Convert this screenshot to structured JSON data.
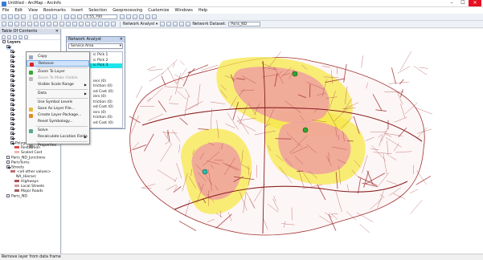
{
  "window": {
    "title": "Untitled - ArcMap - ArcInfo",
    "minimize": "–",
    "maximize": "☐",
    "close": "✕"
  },
  "menu": [
    "File",
    "Edit",
    "View",
    "Bookmarks",
    "Insert",
    "Selection",
    "Geoprocessing",
    "Customize",
    "Windows",
    "Help"
  ],
  "toolbar": {
    "scale": "1:55,700",
    "network_analyst_label": "Network Analyst ▾",
    "network_dataset_label": "Network Dataset:",
    "network_dataset_value": "Paris_ND"
  },
  "toc": {
    "title": "Table Of Contents",
    "close": "✕",
    "items": [
      {
        "label": "Layers",
        "indent": 0,
        "check": false,
        "bold": true
      },
      {
        "label": "",
        "indent": 1,
        "check": true,
        "selected": true
      },
      {
        "label": "",
        "indent": 2,
        "check": true
      },
      {
        "label": "",
        "indent": 2,
        "check": true
      },
      {
        "label": "",
        "indent": 2,
        "check": true
      },
      {
        "label": "",
        "indent": 2,
        "check": true
      },
      {
        "label": "",
        "indent": 2,
        "check": true
      },
      {
        "label": "",
        "indent": 2,
        "check": true
      },
      {
        "label": "",
        "indent": 2,
        "check": true
      },
      {
        "label": "",
        "indent": 2,
        "check": true
      },
      {
        "label": "",
        "indent": 2,
        "check": true
      },
      {
        "label": "",
        "indent": 2,
        "check": true
      },
      {
        "label": "",
        "indent": 2,
        "check": true
      },
      {
        "label": "",
        "indent": 2,
        "check": true
      },
      {
        "label": "",
        "indent": 2,
        "check": true
      },
      {
        "label": "",
        "indent": 2,
        "check": true
      },
      {
        "label": "",
        "indent": 2,
        "check": true
      },
      {
        "label": "",
        "indent": 2,
        "check": true
      },
      {
        "label": "",
        "indent": 2,
        "check": true
      },
      {
        "label": "",
        "indent": 2,
        "check": true
      },
      {
        "label": "",
        "indent": 2,
        "check": true
      },
      {
        "label": "Polygon Barriers",
        "indent": 2,
        "check": true
      },
      {
        "label": "Restriction",
        "indent": 3,
        "swatch": "#e24a4a"
      },
      {
        "label": "Scaled Cost",
        "indent": 3,
        "swatch": "#f2b3b3"
      },
      {
        "label": "Paris_ND_Junctions",
        "indent": 1,
        "check": false
      },
      {
        "label": "ParisTurns",
        "indent": 1,
        "check": false
      },
      {
        "label": "Streets",
        "indent": 1,
        "check": true
      },
      {
        "label": "<all other values>",
        "indent": 2,
        "swatch": "#c07070"
      },
      {
        "label": "NA_Hierarc",
        "indent": 3,
        "swatch": ""
      },
      {
        "label": "Highways",
        "indent": 3,
        "swatch": "#b05050"
      },
      {
        "label": "Local Streets",
        "indent": 3,
        "swatch": "#caa0a0"
      },
      {
        "label": "Major Roads",
        "indent": 3,
        "swatch": "#a06060"
      },
      {
        "label": "Paris_ND",
        "indent": 1,
        "check": false
      }
    ]
  },
  "network_analyst": {
    "title": "Network Analyst",
    "close": "✕",
    "dropdown": "Service Area",
    "rows": [
      {
        "label": "ic Pick 1",
        "highlight": false
      },
      {
        "label": "ic Pick 2",
        "highlight": false
      },
      {
        "label": "ic Pick 3",
        "highlight": true
      },
      {
        "label": "",
        "highlight": false
      },
      {
        "label": "",
        "highlight": false
      },
      {
        "label": "iers (0)",
        "highlight": false
      },
      {
        "label": "triction (0)",
        "highlight": false
      },
      {
        "label": "ed Cost (0)",
        "highlight": false
      },
      {
        "label": "iers (0)",
        "highlight": false
      },
      {
        "label": "triction (0)",
        "highlight": false
      },
      {
        "label": "ed Cost (0)",
        "highlight": false
      },
      {
        "label": "iers (0)",
        "highlight": false
      },
      {
        "label": "triction (0)",
        "highlight": false
      },
      {
        "label": "ed Cost (0)",
        "highlight": false
      }
    ]
  },
  "context_menu": [
    {
      "label": "Copy",
      "icon": "copy-icon",
      "color": "#9ab"
    },
    {
      "label": "Remove",
      "icon": "remove-icon",
      "color": "#d22",
      "hover": true
    },
    {
      "sep": true
    },
    {
      "label": "Zoom To Layer",
      "icon": "zoom-layer-icon",
      "color": "#3a3"
    },
    {
      "label": "Zoom To Make Visible",
      "icon": "zoom-visible-icon",
      "color": "#bbb",
      "disabled": true
    },
    {
      "label": "Visible Scale Range",
      "icon": "",
      "sub": "▶"
    },
    {
      "sep": true
    },
    {
      "label": "Data",
      "icon": "",
      "sub": "▶"
    },
    {
      "sep": true
    },
    {
      "label": "Use Symbol Levels",
      "icon": "",
      "color": ""
    },
    {
      "label": "Save As Layer File...",
      "icon": "save-layer-icon",
      "color": "#e8b83a"
    },
    {
      "label": "Create Layer Package...",
      "icon": "layer-package-icon",
      "color": "#d98c2a"
    },
    {
      "label": "Reset Symbology...",
      "icon": "",
      "color": ""
    },
    {
      "sep": true
    },
    {
      "label": "Solve",
      "icon": "solve-icon",
      "color": "#5a8"
    },
    {
      "label": "Recalculate Location Fields",
      "icon": "",
      "sub": "▶"
    },
    {
      "sep": true
    },
    {
      "label": "Properties...",
      "icon": "properties-icon",
      "color": "#888"
    }
  ],
  "map": {
    "facility_color": "#2fa82f",
    "facility_color_2": "#2cb9b0",
    "polygon_inner": "#f0a0a0",
    "polygon_outer": "#f5e84a",
    "street_color": "#a03030"
  },
  "status": "Remove layer from data frame"
}
